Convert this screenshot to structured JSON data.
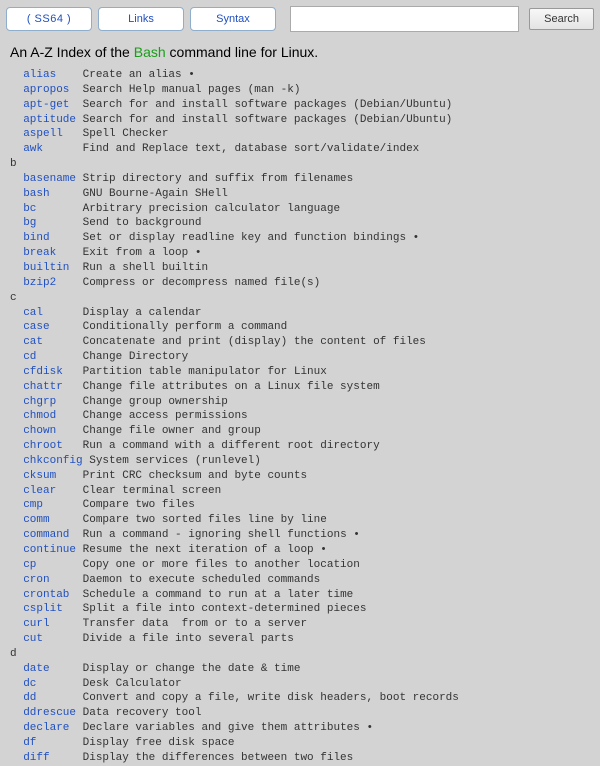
{
  "nav": {
    "logo": "( SS64 )",
    "links": "Links",
    "syntax": "Syntax",
    "search_placeholder": "",
    "search_button": "Search"
  },
  "heading": {
    "prefix": "An A-Z Index of the ",
    "bash": "Bash",
    "suffix": " command line for Linux."
  },
  "commands": [
    {
      "section": null
    },
    {
      "cmd": "alias",
      "pad": 4,
      "desc": "Create an alias •"
    },
    {
      "cmd": "apropos",
      "pad": 2,
      "desc": "Search Help manual pages (man -k)"
    },
    {
      "cmd": "apt-get",
      "pad": 2,
      "desc": "Search for and install software packages (Debian/Ubuntu)"
    },
    {
      "cmd": "aptitude",
      "pad": 1,
      "desc": "Search for and install software packages (Debian/Ubuntu)"
    },
    {
      "cmd": "aspell",
      "pad": 3,
      "desc": "Spell Checker"
    },
    {
      "cmd": "awk",
      "pad": 6,
      "desc": "Find and Replace text, database sort/validate/index"
    },
    {
      "section": "b"
    },
    {
      "cmd": "basename",
      "pad": 1,
      "desc": "Strip directory and suffix from filenames"
    },
    {
      "cmd": "bash",
      "pad": 5,
      "desc": "GNU Bourne-Again SHell"
    },
    {
      "cmd": "bc",
      "pad": 7,
      "desc": "Arbitrary precision calculator language"
    },
    {
      "cmd": "bg",
      "pad": 7,
      "desc": "Send to background"
    },
    {
      "cmd": "bind",
      "pad": 5,
      "desc": "Set or display readline key and function bindings •"
    },
    {
      "cmd": "break",
      "pad": 4,
      "desc": "Exit from a loop •"
    },
    {
      "cmd": "builtin",
      "pad": 2,
      "desc": "Run a shell builtin"
    },
    {
      "cmd": "bzip2",
      "pad": 4,
      "desc": "Compress or decompress named file(s)"
    },
    {
      "section": "c"
    },
    {
      "cmd": "cal",
      "pad": 6,
      "desc": "Display a calendar"
    },
    {
      "cmd": "case",
      "pad": 5,
      "desc": "Conditionally perform a command"
    },
    {
      "cmd": "cat",
      "pad": 6,
      "desc": "Concatenate and print (display) the content of files"
    },
    {
      "cmd": "cd",
      "pad": 7,
      "desc": "Change Directory"
    },
    {
      "cmd": "cfdisk",
      "pad": 3,
      "desc": "Partition table manipulator for Linux"
    },
    {
      "cmd": "chattr",
      "pad": 3,
      "desc": "Change file attributes on a Linux file system"
    },
    {
      "cmd": "chgrp",
      "pad": 4,
      "desc": "Change group ownership"
    },
    {
      "cmd": "chmod",
      "pad": 4,
      "desc": "Change access permissions"
    },
    {
      "cmd": "chown",
      "pad": 4,
      "desc": "Change file owner and group"
    },
    {
      "cmd": "chroot",
      "pad": 3,
      "desc": "Run a command with a different root directory"
    },
    {
      "cmd": "chkconfig",
      "pad": 1,
      "desc": "System services (runlevel)"
    },
    {
      "cmd": "cksum",
      "pad": 4,
      "desc": "Print CRC checksum and byte counts"
    },
    {
      "cmd": "clear",
      "pad": 4,
      "desc": "Clear terminal screen"
    },
    {
      "cmd": "cmp",
      "pad": 6,
      "desc": "Compare two files"
    },
    {
      "cmd": "comm",
      "pad": 5,
      "desc": "Compare two sorted files line by line"
    },
    {
      "cmd": "command",
      "pad": 2,
      "desc": "Run a command - ignoring shell functions •"
    },
    {
      "cmd": "continue",
      "pad": 1,
      "desc": "Resume the next iteration of a loop •"
    },
    {
      "cmd": "cp",
      "pad": 7,
      "desc": "Copy one or more files to another location"
    },
    {
      "cmd": "cron",
      "pad": 5,
      "desc": "Daemon to execute scheduled commands"
    },
    {
      "cmd": "crontab",
      "pad": 2,
      "desc": "Schedule a command to run at a later time"
    },
    {
      "cmd": "csplit",
      "pad": 3,
      "desc": "Split a file into context-determined pieces"
    },
    {
      "cmd": "curl",
      "pad": 5,
      "desc": "Transfer data  from or to a server"
    },
    {
      "cmd": "cut",
      "pad": 6,
      "desc": "Divide a file into several parts"
    },
    {
      "section": "d"
    },
    {
      "cmd": "date",
      "pad": 5,
      "desc": "Display or change the date & time"
    },
    {
      "cmd": "dc",
      "pad": 7,
      "desc": "Desk Calculator"
    },
    {
      "cmd": "dd",
      "pad": 7,
      "desc": "Convert and copy a file, write disk headers, boot records"
    },
    {
      "cmd": "ddrescue",
      "pad": 1,
      "desc": "Data recovery tool"
    },
    {
      "cmd": "declare",
      "pad": 2,
      "desc": "Declare variables and give them attributes •"
    },
    {
      "cmd": "df",
      "pad": 7,
      "desc": "Display free disk space"
    },
    {
      "cmd": "diff",
      "pad": 5,
      "desc": "Display the differences between two files"
    }
  ]
}
